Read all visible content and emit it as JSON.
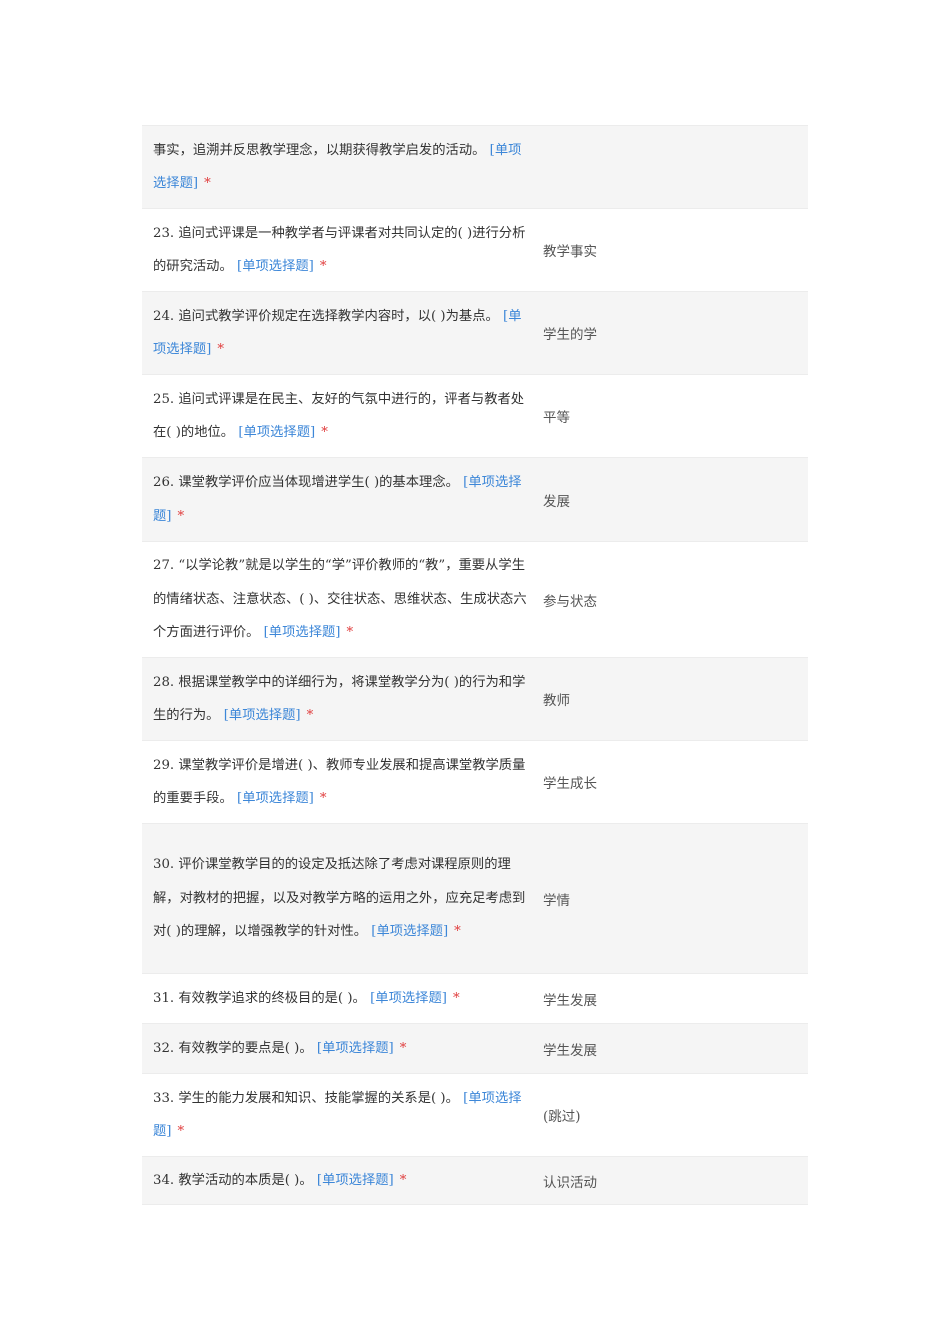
{
  "type_tag": "[单项选择题]",
  "required_mark": "*",
  "rows": [
    {
      "question": "事实，追溯并反思教学理念，以期获得教学启发的活动。",
      "tag": "[单项选择题]",
      "answer": ""
    },
    {
      "question": "23. 追问式评课是一种教学者与评课者对共同认定的( )进行分析的研究活动。",
      "tag": "[单项选择题]",
      "answer": "教学事实"
    },
    {
      "question": "24. 追问式教学评价规定在选择教学内容时，以( )为基点。",
      "tag": "[单项选择题]",
      "answer": "学生的学"
    },
    {
      "question": "25. 追问式评课是在民主、友好的气氛中进行的，评者与教者处在( )的地位。",
      "tag": "[单项选择题]",
      "answer": "平等"
    },
    {
      "question": "26. 课堂教学评价应当体现增进学生( )的基本理念。",
      "tag": "[单项选择题]",
      "answer": "发展"
    },
    {
      "question": "27. “以学论教”就是以学生的“学”评价教师的“教”，重要从学生的情绪状态、注意状态、( )、交往状态、思维状态、生成状态六个方面进行评价。",
      "tag": "[单项选择题]",
      "answer": "参与状态"
    },
    {
      "question": "28. 根据课堂教学中的详细行为，将课堂教学分为( )的行为和学生的行为。",
      "tag": "[单项选择题]",
      "answer": "教师"
    },
    {
      "question": "29. 课堂教学评价是增进( )、教师专业发展和提高课堂教学质量的重要手段。",
      "tag": "[单项选择题]",
      "answer": "学生成长"
    },
    {
      "question": "30. 评价课堂教学目的的设定及抵达除了考虑对课程原则的理解，对教材的把握，以及对教学方略的运用之外，应充足考虑到对( )的理解，以增强教学的针对性。",
      "tag": "[单项选择题]",
      "answer": "学情"
    },
    {
      "question": "31. 有效教学追求的终极目的是( )。",
      "tag": "[单项选择题]",
      "answer": "学生发展"
    },
    {
      "question": "32. 有效教学的要点是( )。",
      "tag": "[单项选择题]",
      "answer": "学生发展"
    },
    {
      "question": "33. 学生的能力发展和知识、技能掌握的关系是( )。",
      "tag": "[单项选择题]",
      "answer": "(跳过)"
    },
    {
      "question": "34. 教学活动的本质是( )。",
      "tag": "[单项选择题]",
      "answer": "认识活动"
    }
  ]
}
